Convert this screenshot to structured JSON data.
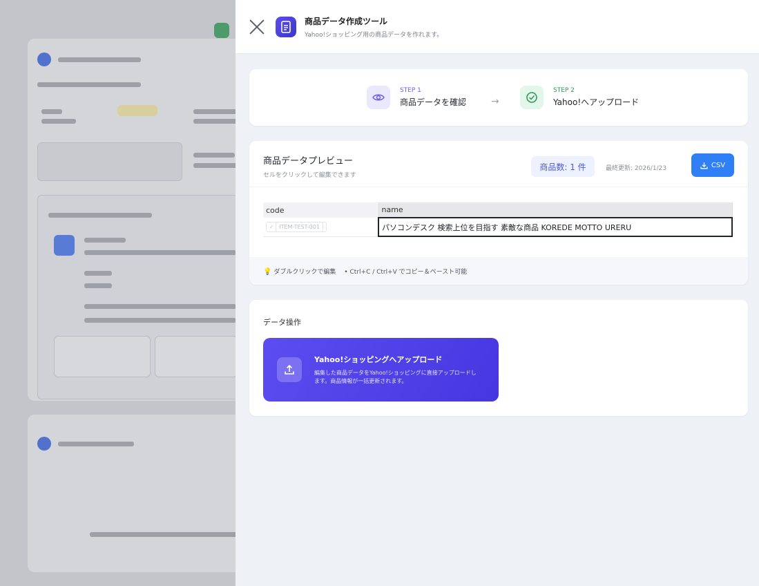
{
  "drawer": {
    "title": "商品データ作成ツール",
    "subtitle": "Yahoo!ショッピング用の商品データを作れます。"
  },
  "steps": [
    {
      "num": "STEP 1",
      "label": "商品データを確認"
    },
    {
      "num": "STEP 2",
      "label": "Yahoo!へアップロード"
    }
  ],
  "preview": {
    "title": "商品データプレビュー",
    "subtitle": "セルをクリックして編集できます",
    "count_badge": "商品数: 1 件",
    "updated": "最終更新: 2026/1/23",
    "csv_button": "CSV",
    "columns": [
      "code",
      "name"
    ],
    "rows": [
      {
        "code": "ITEM-TEST-001",
        "name": "パソコンデスク 検索上位を目指す 素敵な商品 KOREDE MOTTO URERU"
      }
    ],
    "hint_edit": "ダブルクリックで編集",
    "hint_copy": "• Ctrl+C / Ctrl+V でコピー＆ペースト可能"
  },
  "operations": {
    "title": "データ操作",
    "upload_title": "Yahoo!ショッピングへアップロード",
    "upload_desc": "編集した商品データをYahoo!ショッピングに直接アップロードします。商品情報が一括更新されます。"
  },
  "colors": {
    "accent": "#5b4df0",
    "csv_blue": "#2f7ff6",
    "step2_green": "#2f9a58"
  }
}
